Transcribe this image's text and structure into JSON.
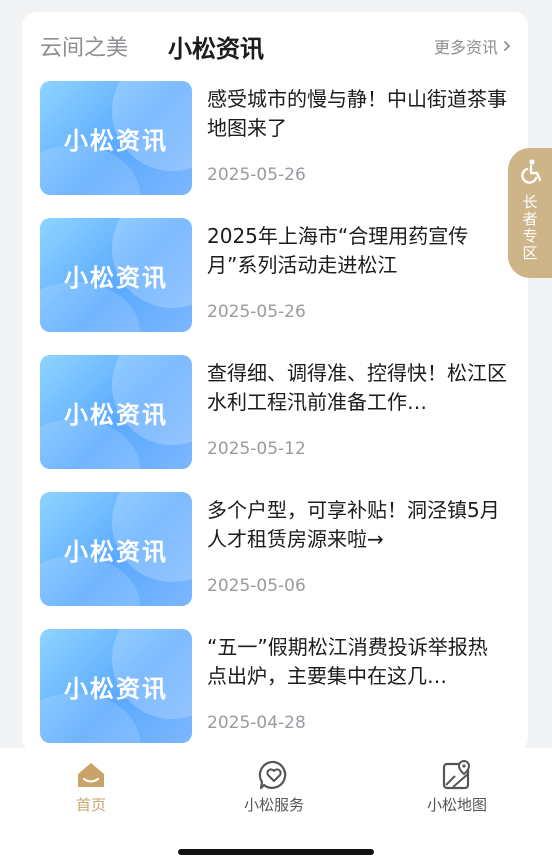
{
  "header": {
    "tab_inactive": "云间之美",
    "tab_active": "小松资讯",
    "more_label": "更多资讯"
  },
  "news": [
    {
      "thumb_text": "小松资讯",
      "title": "感受城市的慢与静！中山街道茶事地图来了",
      "date": "2025-05-26"
    },
    {
      "thumb_text": "小松资讯",
      "title": "2025年上海市“合理用药宣传月”系列活动走进松江",
      "date": "2025-05-26"
    },
    {
      "thumb_text": "小松资讯",
      "title": "查得细、调得准、控得快！松江区水利工程汛前准备工作…",
      "date": "2025-05-12"
    },
    {
      "thumb_text": "小松资讯",
      "title": "多个户型，可享补贴！洞泾镇5月人才租赁房源来啦→",
      "date": "2025-05-06"
    },
    {
      "thumb_text": "小松资讯",
      "title": "“五一”假期松江消费投诉举报热点出炉，主要集中在这几…",
      "date": "2025-04-28"
    }
  ],
  "side_badge": {
    "label": "长者专区",
    "icon": "wheelchair-icon"
  },
  "tabbar": {
    "items": [
      {
        "label": "首页",
        "icon": "home-icon",
        "active": true
      },
      {
        "label": "小松服务",
        "icon": "heart-chat-icon",
        "active": false
      },
      {
        "label": "小松地图",
        "icon": "map-icon",
        "active": false
      }
    ]
  },
  "colors": {
    "accent": "#c9a46a",
    "inactive": "#555555",
    "badge": "#cdb589"
  }
}
